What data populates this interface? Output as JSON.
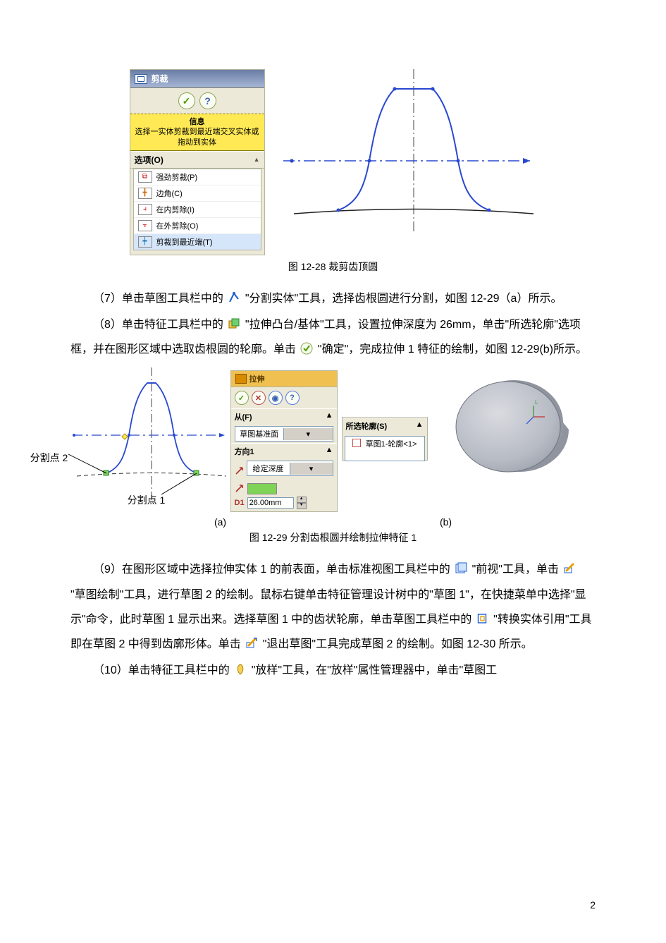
{
  "fig28": {
    "panel_title": "剪裁",
    "info_header": "信息",
    "info_text": "选择一实体剪裁到最近端交叉实体或拖动到实体",
    "options_header": "选项(O)",
    "options": [
      "强劲剪裁(P)",
      "边角(C)",
      "在内剪除(I)",
      "在外剪除(O)",
      "剪裁到最近端(T)"
    ]
  },
  "caption28": "图 12-28  裁剪齿顶圆",
  "para7_a": "（7）单击草图工具栏中的",
  "para7_b": "\"分割实体\"工具，选择齿根圆进行分割，如图 12-29（a）所示。",
  "para8_a": "（8）单击特征工具栏中的",
  "para8_b": "\"拉伸凸台/基体\"工具，设置拉伸深度为 26mm，单击\"所选轮廓\"选项框，并在图形区域中选取齿根圆的轮廓。单击",
  "para8_c": "\"确定\"，完成拉伸 1 特征的绘制，如图 12-29(b)所示。",
  "fig29": {
    "split_pt1": "分割点 1",
    "split_pt2": "分割点 2",
    "panel_title": "拉伸",
    "from_header": "从(F)",
    "from_value": "草图基准面",
    "dir_header": "方向1",
    "cond_value": "给定深度",
    "depth_label": "D1",
    "depth_value": "26.00mm",
    "sel_header": "所选轮廓(S)",
    "sel_item": "草图1-轮廓<1>",
    "sub_a": "(a)",
    "sub_b": "(b)"
  },
  "caption29": "图 12-29    分割齿根圆并绘制拉伸特征 1",
  "para9_a": "（9）在图形区域中选择拉伸实体 1 的前表面，单击标准视图工具栏中的",
  "para9_b": "\"前视\"工具，单击",
  "para9_c": "\"草图绘制\"工具，进行草图 2 的绘制。鼠标右键单击特征管理设计树中的\"草图 1\"，在快捷菜单中选择\"显示\"命令，此时草图 1 显示出来。选择草图 1 中的齿状轮廓，单击草图工具栏中的",
  "para9_d": "\"转换实体引用\"工具即在草图 2 中得到齿廓形体。单击",
  "para9_e": "\"退出草图\"工具完成草图 2 的绘制。如图 12-30 所示。",
  "para10_a": "（10）单击特征工具栏中的",
  "para10_b": "\"放样\"工具，在\"放样\"属性管理器中，单击\"草图工",
  "page_number": "2"
}
